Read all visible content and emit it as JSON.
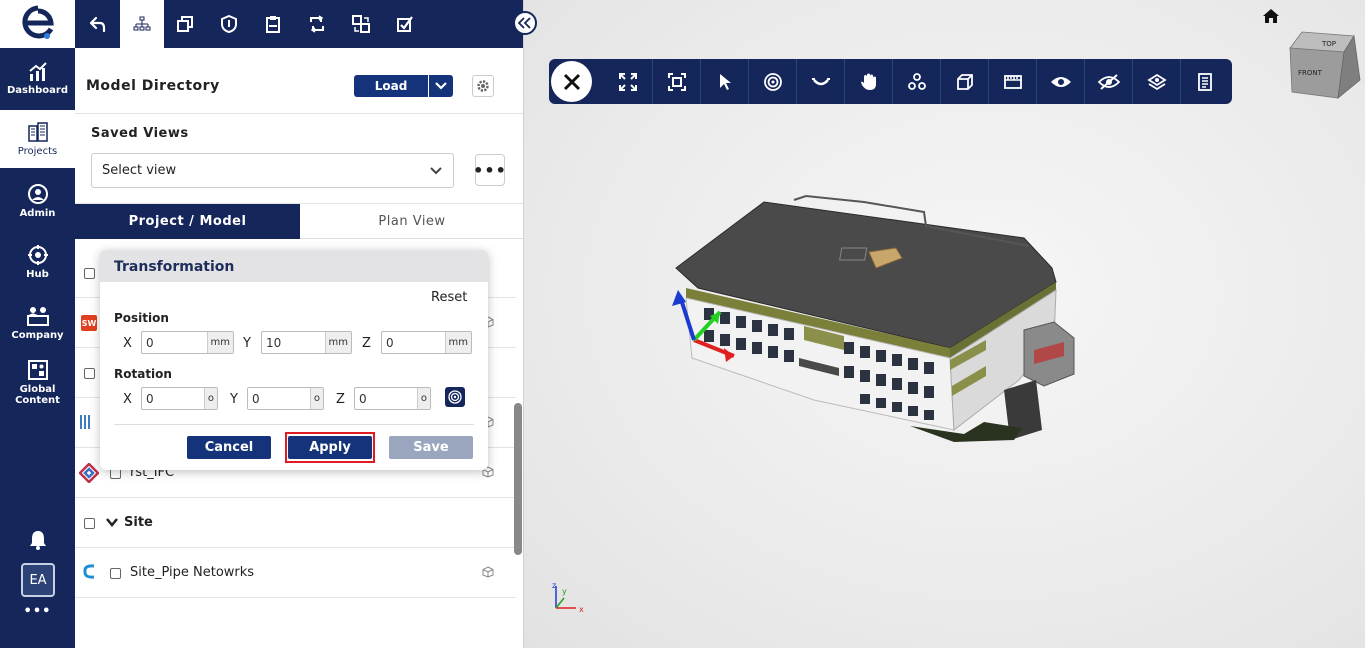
{
  "nav": {
    "items": [
      {
        "label": "Dashboard",
        "icon": "chart-line-icon"
      },
      {
        "label": "Projects",
        "icon": "buildings-icon"
      },
      {
        "label": "Admin",
        "icon": "admin-gear-icon"
      },
      {
        "label": "Hub",
        "icon": "hub-icon"
      },
      {
        "label": "Company",
        "icon": "company-icon"
      },
      {
        "label": "Global Content",
        "icon": "global-content-icon"
      }
    ],
    "avatar": "EA",
    "more": "•••"
  },
  "panel": {
    "title": "Model Directory",
    "load_label": "Load",
    "saved_views_title": "Saved Views",
    "select_view_placeholder": "Select view",
    "more_label": "•••",
    "tabs": [
      {
        "label": "Project / Model",
        "active": true
      },
      {
        "label": "Plan View",
        "active": false
      }
    ],
    "rows": [
      {
        "label": "rst_IFC"
      },
      {
        "label": "Site"
      },
      {
        "label": "Site_Pipe Netowrks"
      }
    ]
  },
  "transformation": {
    "title": "Transformation",
    "reset_label": "Reset",
    "position": {
      "title": "Position",
      "x_label": "X",
      "x_value": "0",
      "x_unit": "mm",
      "y_label": "Y",
      "y_value": "10",
      "y_unit": "mm",
      "z_label": "Z",
      "z_value": "0",
      "z_unit": "mm"
    },
    "rotation": {
      "title": "Rotation",
      "x_label": "X",
      "x_value": "0",
      "x_unit": "o",
      "y_label": "Y",
      "y_value": "0",
      "y_unit": "o",
      "z_label": "Z",
      "z_value": "0",
      "z_unit": "o"
    },
    "cancel_label": "Cancel",
    "apply_label": "Apply",
    "save_label": "Save"
  },
  "viewer": {
    "cube_top": "TOP",
    "cube_front": "FRONT",
    "axes": {
      "x": "x",
      "y": "y",
      "z": "z"
    }
  },
  "colors": {
    "navy": "#14265a",
    "button_blue": "#14337a",
    "highlight_red": "#e01b24",
    "disabled_button": "#9aa5be"
  }
}
